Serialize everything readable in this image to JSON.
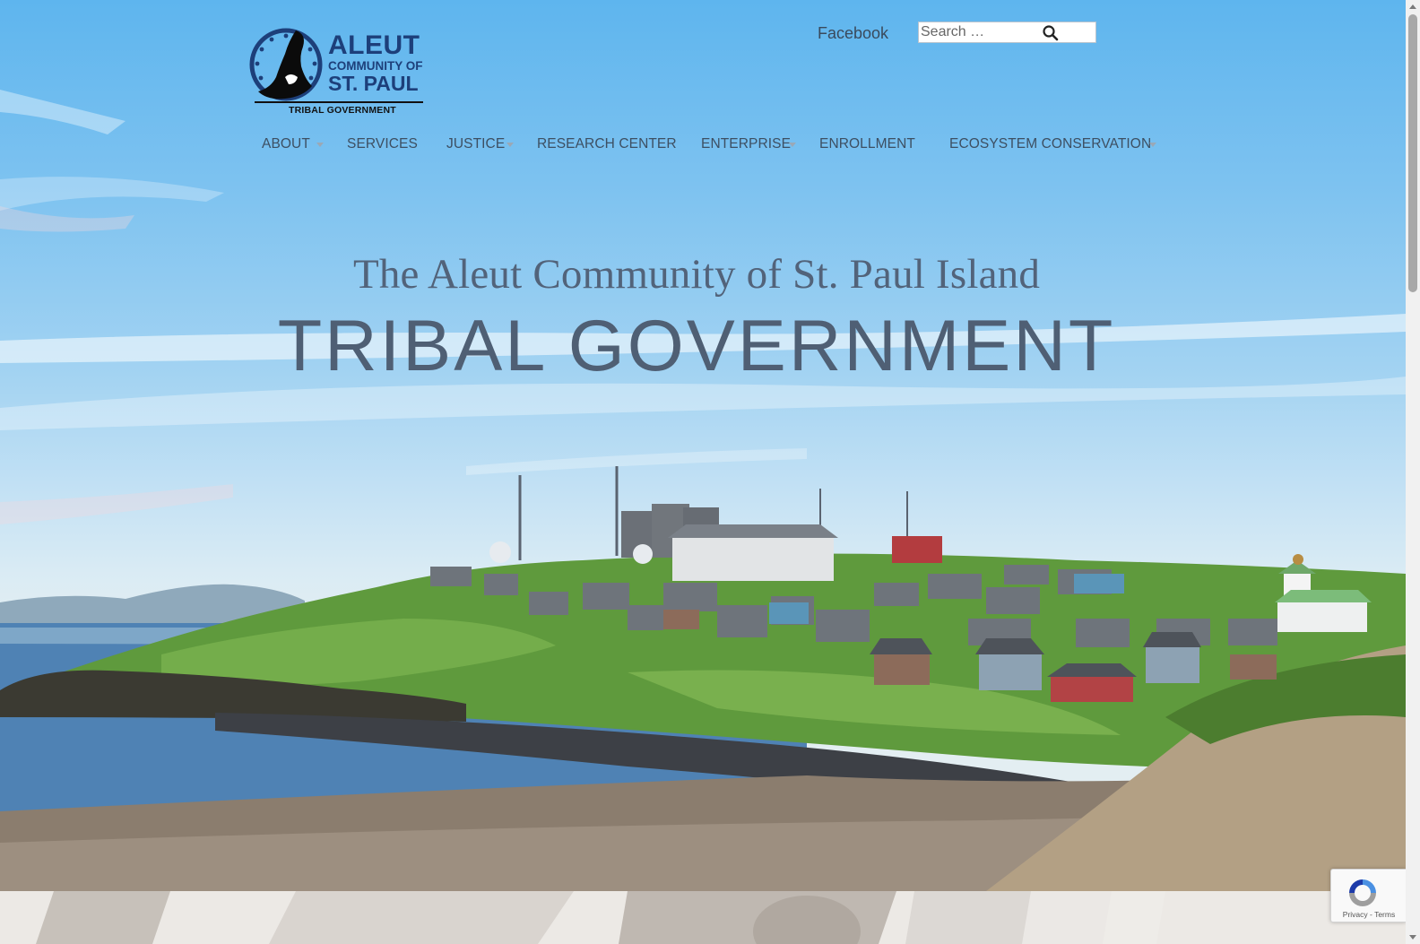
{
  "logo": {
    "line1": "ALEUT",
    "line2": "COMMUNITY OF",
    "line3": "ST. PAUL",
    "line4": "TRIBAL GOVERNMENT"
  },
  "header": {
    "facebook_label": "Facebook",
    "search_placeholder": "Search …",
    "search_icon": "search-icon"
  },
  "nav": {
    "items": [
      {
        "label": "ABOUT",
        "has_submenu": true
      },
      {
        "label": "SERVICES",
        "has_submenu": false
      },
      {
        "label": "JUSTICE",
        "has_submenu": true
      },
      {
        "label": "RESEARCH CENTER",
        "has_submenu": false
      },
      {
        "label": "ENTERPRISE",
        "has_submenu": true
      },
      {
        "label": "ENROLLMENT",
        "has_submenu": false
      },
      {
        "label": "ECOSYSTEM CONSERVATION",
        "has_submenu": true
      }
    ]
  },
  "hero": {
    "subtitle": "The Aleut Community of St. Paul Island",
    "title": "TRIBAL GOVERNMENT"
  },
  "recaptcha": {
    "links": "Privacy - Terms",
    "icon": "recaptcha-icon"
  },
  "colors": {
    "nav_text": "#3d4f62",
    "title_text": "#4f5f74",
    "logo_blue": "#1d3f7a"
  }
}
